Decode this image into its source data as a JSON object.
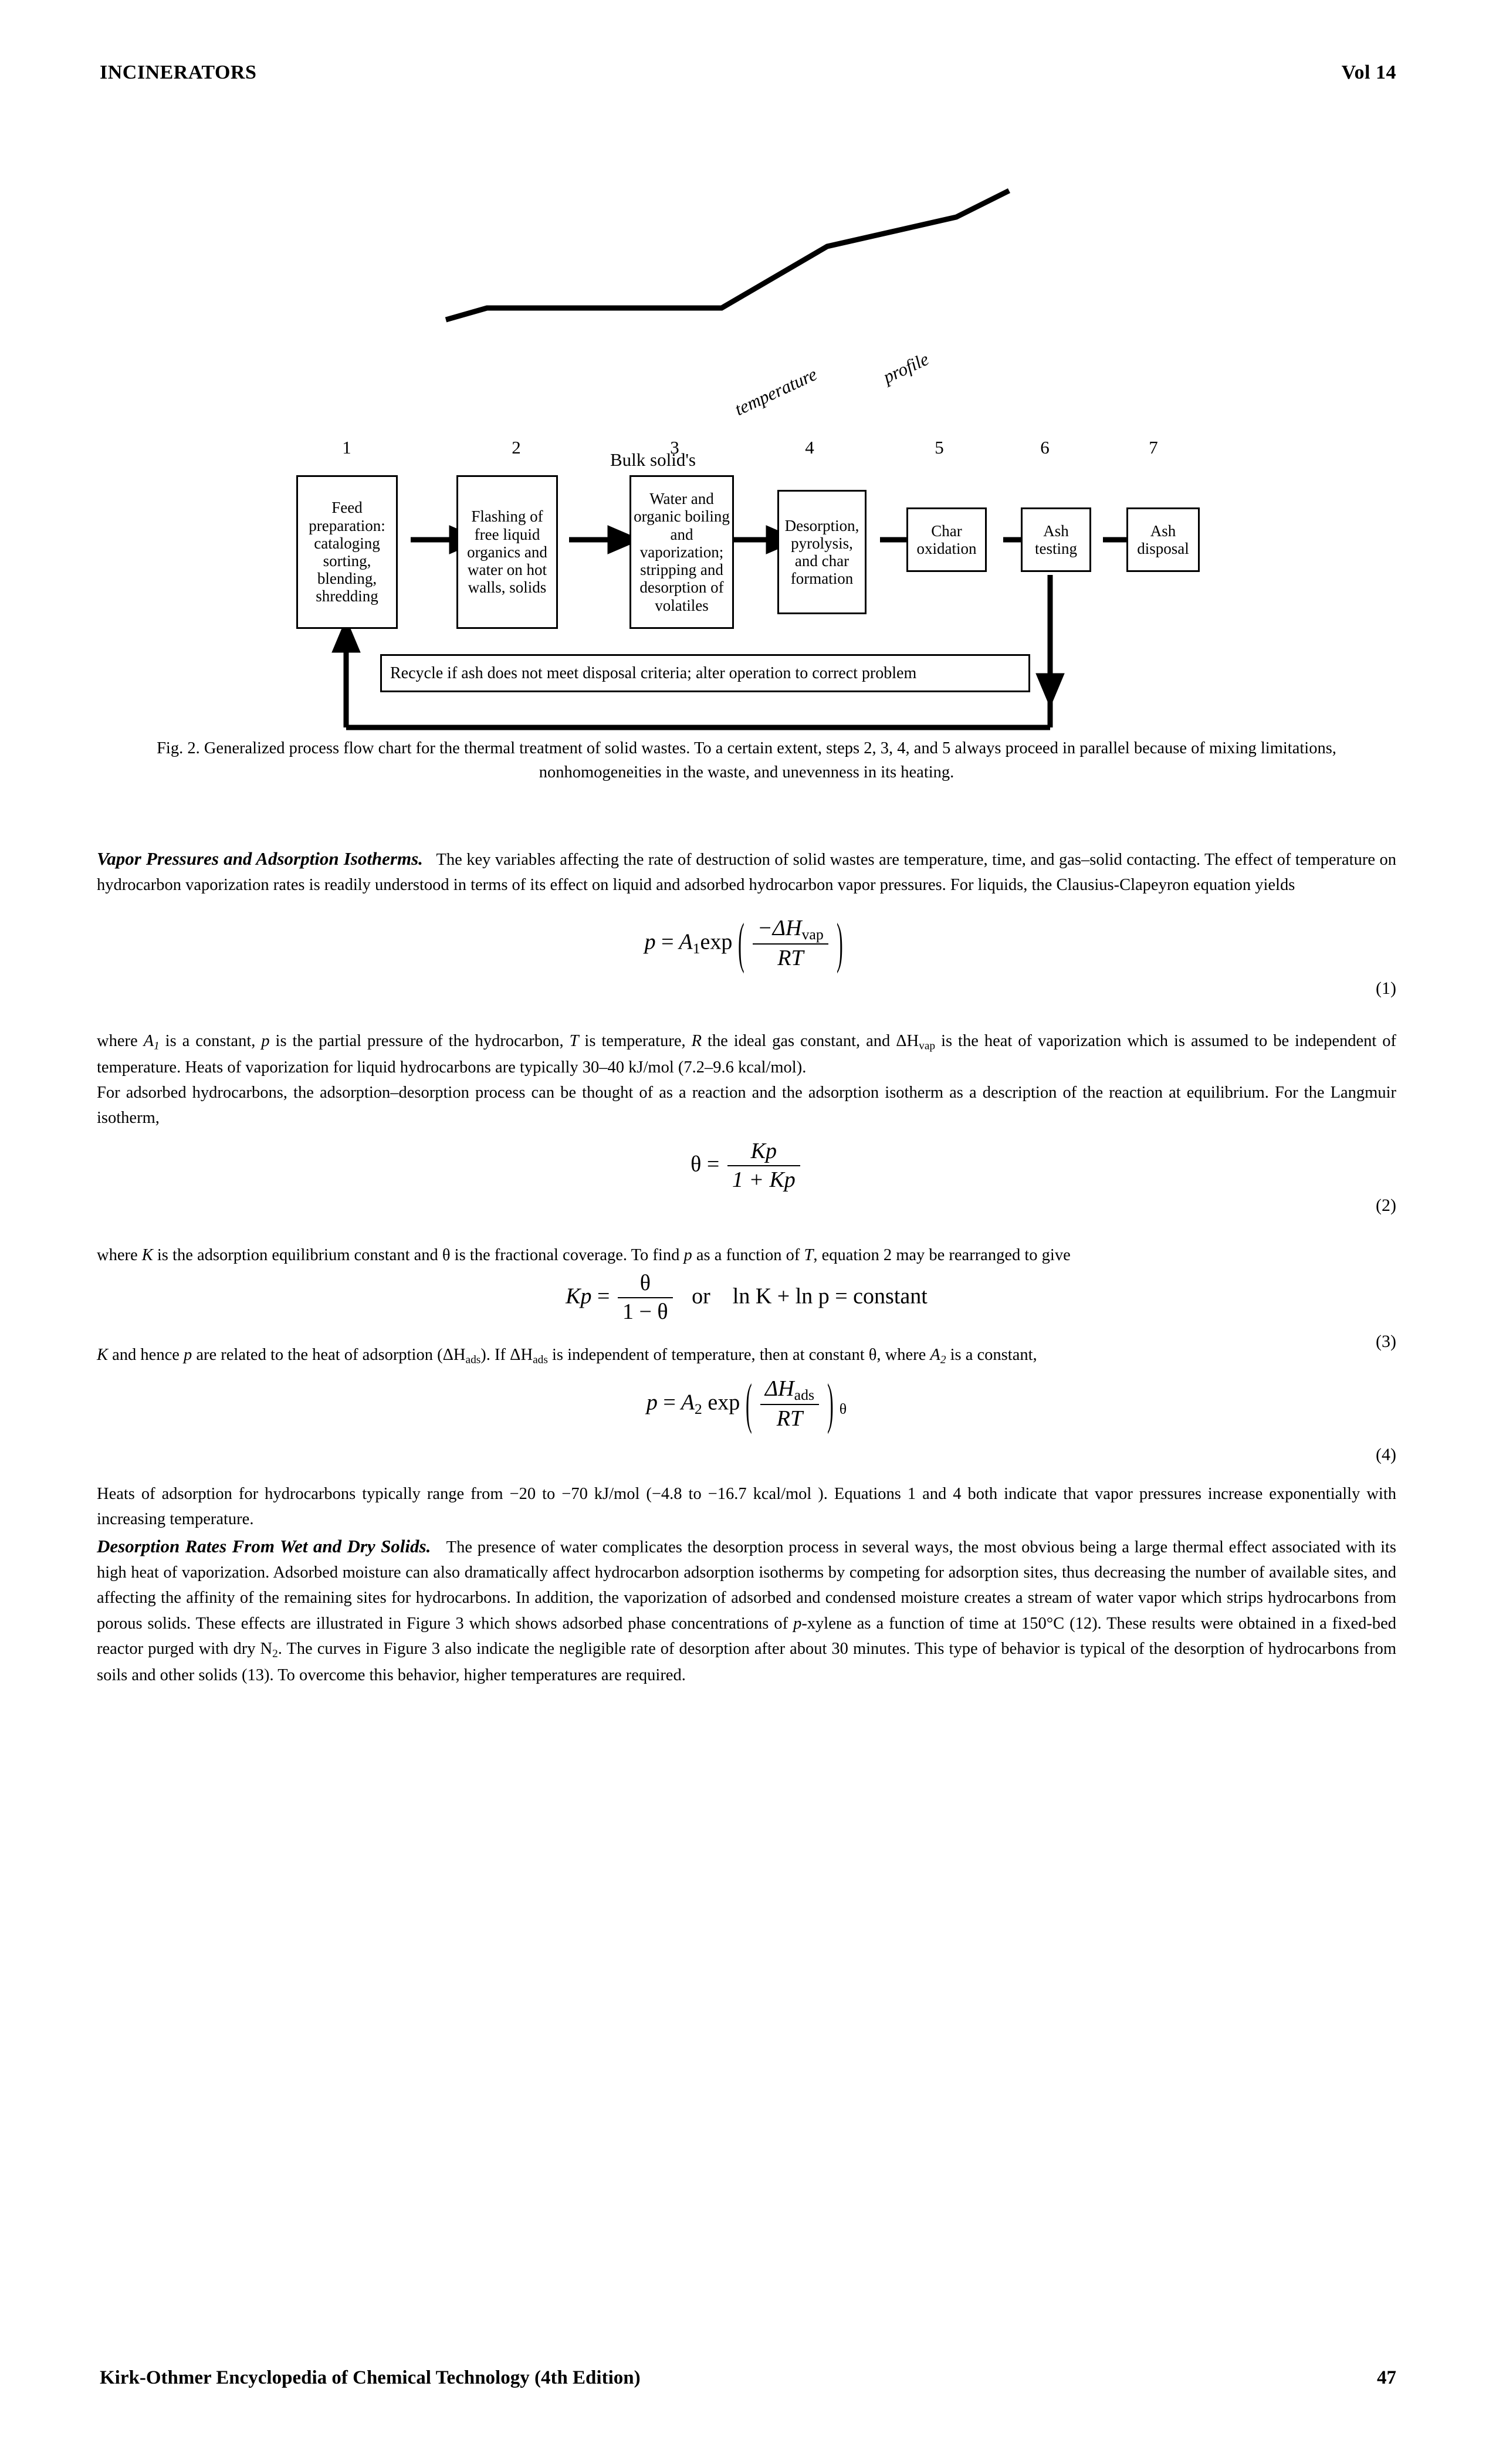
{
  "header": {
    "left": "INCINERATORS",
    "right": "Vol 14"
  },
  "figure": {
    "profile_labels": {
      "bulk": "Bulk solid's",
      "temperature": "temperature",
      "profile": "profile"
    },
    "step_numbers": [
      "1",
      "2",
      "3",
      "4",
      "5",
      "6",
      "7"
    ],
    "boxes": [
      "Feed preparation: cataloging sorting, blending, shredding",
      "Flashing of free liquid organics and water on hot walls, solids",
      "Water and organic boiling and vaporization; stripping and desorption of volatiles",
      "Desorption, pyrolysis, and char formation",
      "Char oxidation",
      "Ash testing",
      "Ash disposal"
    ],
    "recycle_note": "Recycle if ash does not meet disposal criteria; alter operation to correct problem",
    "caption": "Fig. 2. Generalized process flow chart for the thermal treatment of solid wastes. To a certain extent, steps 2, 3, 4, and 5 always proceed in parallel because of mixing limitations, nonhomogeneities in the waste, and unevenness in its heating."
  },
  "sections": {
    "vapor_heading": "Vapor Pressures and Adsorption Isotherms.",
    "vapor_para": "The key variables affecting the rate of destruction of solid wastes are temperature, time, and gas–solid contacting. The effect of temperature on hydrocarbon vaporization rates is readily understood in terms of its effect on liquid and adsorbed hydrocarbon vapor pressures. For liquids, the Clausius-Clapeyron equation yields",
    "after_eq1_a": "where",
    "after_eq1_b": "is a constant,",
    "after_eq1_c": "is the partial pressure of the hydrocarbon,",
    "after_eq1_d": "is temperature,",
    "after_eq1_e": "the ideal gas constant, and",
    "after_eq1_f": "is the heat of vaporization which is assumed to be independent of temperature. Heats of vaporization for liquid hydrocarbons are typically 30–40 kJ/mol (7.2–9.6 kcal/mol).",
    "langmuir_para": "For adsorbed hydrocarbons, the adsorption–desorption process can be thought of as a reaction and the adsorption isotherm as a description of the reaction at equilibrium. For the Langmuir isotherm,",
    "after_eq2_a": "where",
    "after_eq2_b": "is the adsorption equilibrium constant and θ is the fractional coverage. To find",
    "after_eq2_c": "as a function of",
    "after_eq2_d": ", equation 2 may be rearranged to give",
    "after_eq3_a": "and hence",
    "after_eq3_b": "are related to the heat of adsorption (ΔH",
    "after_eq3_c": "). If ΔH",
    "after_eq3_d": "is independent of temperature, then at constant θ, where",
    "after_eq3_e": "is a constant,",
    "after_eq4": "Heats of adsorption for hydrocarbons typically range from −20 to −70 kJ/mol (−4.8 to −16.7 kcal/mol ). Equations 1 and 4 both indicate that vapor pressures increase exponentially with increasing temperature.",
    "desorption_heading": "Desorption Rates From Wet and Dry Solids.",
    "desorption_para": "The presence of water complicates the desorption process in several ways, the most obvious being a large thermal effect associated with its high heat of vaporization. Adsorbed moisture can also dramatically affect hydrocarbon adsorption isotherms by competing for adsorption sites, thus decreasing the number of available sites, and affecting the affinity of the remaining sites for hydrocarbons. In addition, the vaporization of adsorbed and condensed moisture creates a stream of water vapor which strips hydrocarbons from porous solids. These effects are illustrated in Figure 3 which shows adsorbed phase concentrations of",
    "desorption_para2": "-xylene as a function of time at 150°C (12). These results were obtained in a fixed-bed reactor purged with dry N",
    "desorption_para3": ". The curves in Figure 3 also indicate the negligible rate of desorption after about 30 minutes. This type of behavior is typical of the desorption of hydrocarbons from soils and other solids (13). To overcome this behavior, higher temperatures are required."
  },
  "equations": {
    "eq1": {
      "lhs": "p",
      "eq": "=",
      "coef": "A",
      "coef_sub": "1",
      "fn": "exp",
      "num": "−ΔH",
      "num_sub": "vap",
      "den": "RT",
      "number": "(1)"
    },
    "eq2": {
      "lhs": "θ",
      "eq": "=",
      "num": "Kp",
      "den": "1 + Kp",
      "number": "(2)"
    },
    "eq3": {
      "lhs": "Kp",
      "eq": "=",
      "num": "θ",
      "den": "1 − θ",
      "or": "or",
      "rhs": "ln K + ln p = constant",
      "number": "(3)"
    },
    "eq4": {
      "lhs": "p",
      "eq": "=",
      "coef": "A",
      "coef_sub": "2",
      "fn": "exp",
      "num": "ΔH",
      "num_sub": "ads",
      "den": "RT",
      "outer_sub": "θ",
      "number": "(4)"
    }
  },
  "footer": {
    "left": "Kirk-Othmer Encyclopedia of Chemical Technology (4th Edition)",
    "right": "47"
  }
}
